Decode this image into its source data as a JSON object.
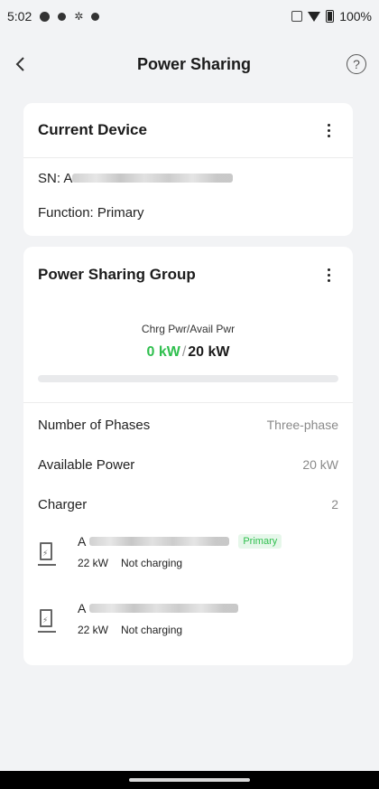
{
  "status_bar": {
    "time": "5:02",
    "battery_percent": "100%",
    "icons": [
      "g-pay-icon",
      "dot-icon",
      "fan-icon",
      "dot-icon"
    ]
  },
  "header": {
    "title": "Power Sharing",
    "back_icon": "chevron-left-icon",
    "help_icon": "question-circle-icon",
    "help_glyph": "?"
  },
  "current_device": {
    "title": "Current Device",
    "sn_label": "SN: A",
    "function_text": "Function: Primary"
  },
  "group": {
    "title": "Power Sharing Group",
    "power_label": "Chrg Pwr/Avail Pwr",
    "charging_power": "0 kW",
    "separator": "/",
    "available_power": "20 kW",
    "progress_fraction": 0,
    "rows": [
      {
        "key": "Number of Phases",
        "value": "Three-phase"
      },
      {
        "key": "Available Power",
        "value": "20 kW"
      },
      {
        "key": "Charger",
        "value": "2"
      }
    ],
    "chargers": [
      {
        "name_prefix": "A",
        "badge": "Primary",
        "power": "22 kW",
        "status": "Not charging"
      },
      {
        "name_prefix": "A",
        "badge": "",
        "power": "22 kW",
        "status": "Not charging"
      }
    ]
  },
  "colors": {
    "accent_green": "#2fbf4e",
    "background": "#f2f3f5",
    "card": "#ffffff"
  }
}
